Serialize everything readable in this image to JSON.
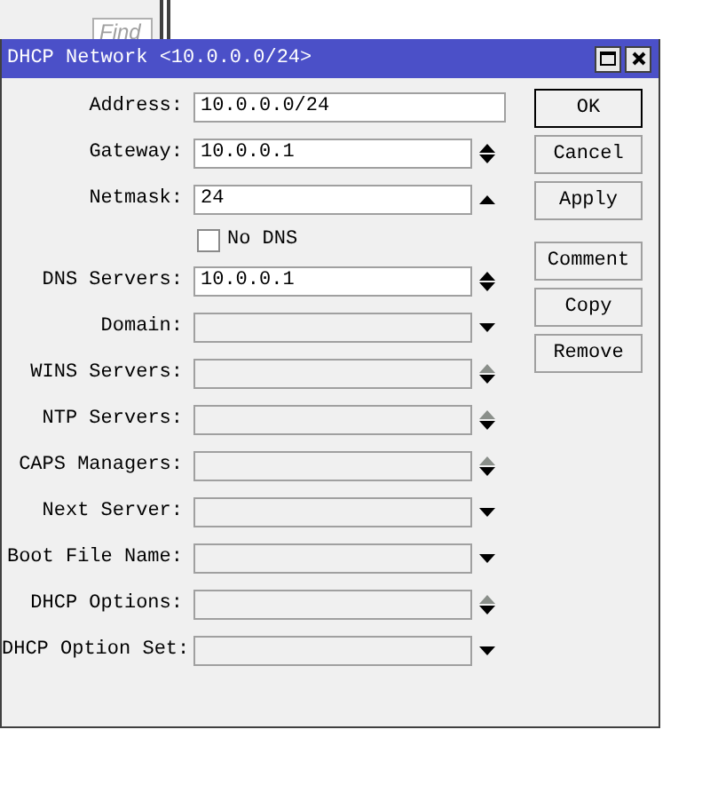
{
  "background": {
    "find_button": "Find"
  },
  "window": {
    "title": "DHCP Network <10.0.0.0/24>"
  },
  "fields": [
    {
      "kind": "text",
      "label": "Address:",
      "value": "10.0.0.0/24",
      "enabled": true
    },
    {
      "kind": "updown",
      "label": "Gateway:",
      "value": "10.0.0.1",
      "enabled": true,
      "up_enabled": true
    },
    {
      "kind": "up",
      "label": "Netmask:",
      "value": "24",
      "enabled": true
    },
    {
      "kind": "checkbox",
      "label": "No DNS",
      "checked": false
    },
    {
      "kind": "updown",
      "label": "DNS Servers:",
      "value": "10.0.0.1",
      "enabled": true,
      "up_enabled": true
    },
    {
      "kind": "dropdown",
      "label": "Domain:",
      "enabled": false
    },
    {
      "kind": "updown",
      "label": "WINS Servers:",
      "enabled": false,
      "up_enabled": false
    },
    {
      "kind": "updown",
      "label": "NTP Servers:",
      "enabled": false,
      "up_enabled": false
    },
    {
      "kind": "updown",
      "label": "CAPS Managers:",
      "enabled": false,
      "up_enabled": false
    },
    {
      "kind": "dropdown",
      "label": "Next Server:",
      "enabled": false
    },
    {
      "kind": "dropdown",
      "label": "Boot File Name:",
      "enabled": false
    },
    {
      "kind": "updown",
      "label": "DHCP Options:",
      "enabled": false,
      "up_enabled": false
    },
    {
      "kind": "dropdown",
      "label": "DHCP Option Set:",
      "enabled": false
    }
  ],
  "button_groups": [
    [
      {
        "label": "OK",
        "default": true
      },
      {
        "label": "Cancel",
        "default": false
      },
      {
        "label": "Apply",
        "default": false
      }
    ],
    [
      {
        "label": "Comment",
        "default": false
      },
      {
        "label": "Copy",
        "default": false
      },
      {
        "label": "Remove",
        "default": false
      }
    ]
  ]
}
